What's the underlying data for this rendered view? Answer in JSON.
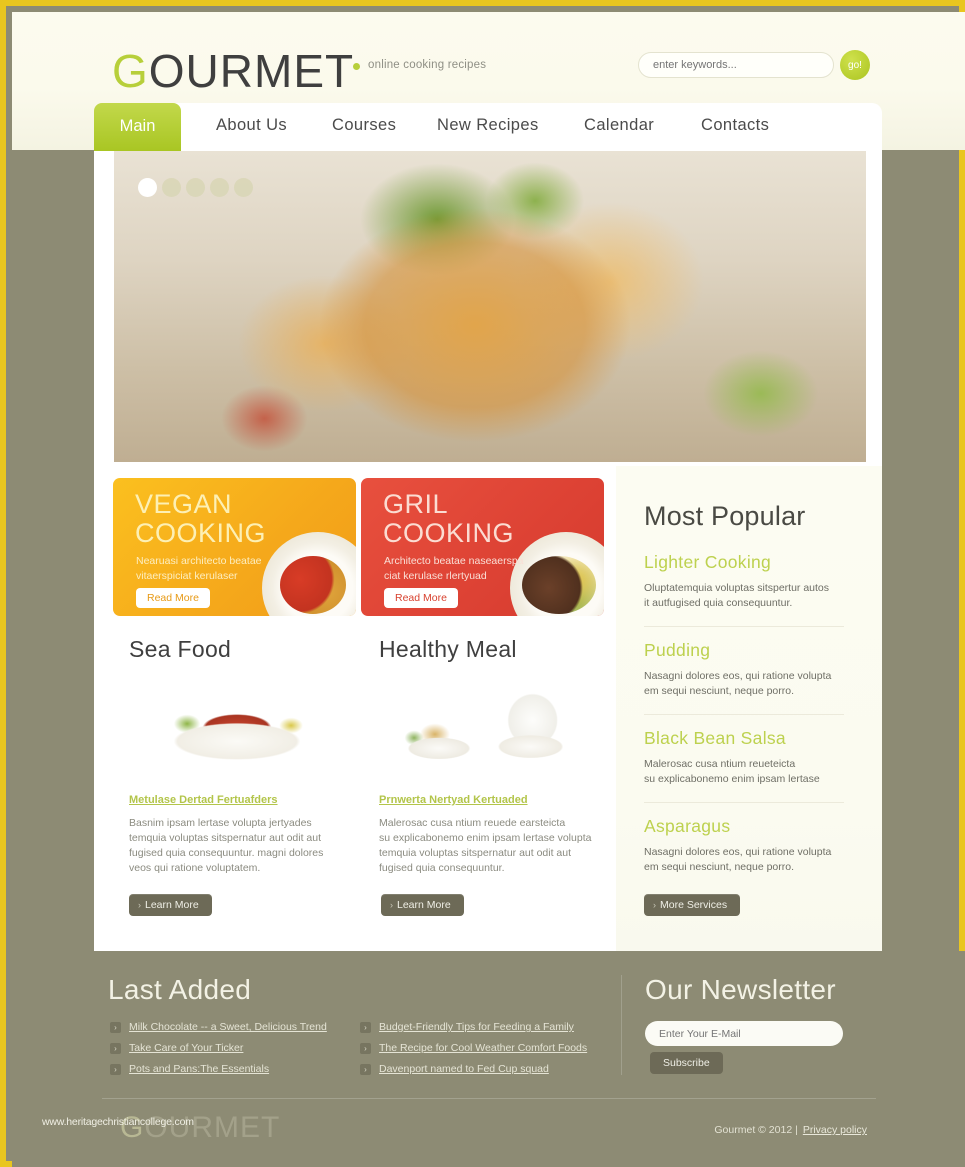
{
  "site": {
    "logo_g": "G",
    "logo_rest": "OURMET",
    "tagline": "online cooking recipes"
  },
  "search": {
    "placeholder": "enter keywords...",
    "value": "",
    "button_label": "go!"
  },
  "nav": {
    "items": [
      {
        "label": "Main",
        "active": true
      },
      {
        "label": "About Us",
        "active": false
      },
      {
        "label": "Courses",
        "active": false
      },
      {
        "label": "New Recipes",
        "active": false
      },
      {
        "label": "Calendar",
        "active": false
      },
      {
        "label": "Contacts",
        "active": false
      }
    ]
  },
  "slider": {
    "dots": 5,
    "active_index": 0
  },
  "promos": [
    {
      "title_line1": "VEGAN",
      "title_line2": "COOKING",
      "desc_line1": "Nearuasi architecto beatae",
      "desc_line2": "vitaerspiciat kerulaser",
      "button_label": "Read More",
      "color": "#f5a81b"
    },
    {
      "title_line1": "GRIL",
      "title_line2": "COOKING",
      "desc_line1": "Architecto beatae naseaerspa",
      "desc_line2": "ciat kerulase rlertyuad",
      "button_label": "Read More",
      "color": "#dd4234"
    }
  ],
  "sidebar": {
    "title": "Most Popular",
    "items": [
      {
        "heading": "Lighter Cooking",
        "line1": "Oluptatemquia voluptas sitspertur autos",
        "line2": "it autfugised quia consequuntur."
      },
      {
        "heading": "Pudding",
        "line1": "Nasagni dolores eos, qui ratione volupta",
        "line2": "em sequi nesciunt, neque porro."
      },
      {
        "heading": "Black Bean Salsa",
        "line1": "Malerosac cusa ntium reueteicta",
        "line2": "su explicabonemo enim ipsam lertase"
      },
      {
        "heading": "Asparagus",
        "line1": "Nasagni dolores eos, qui ratione volupta",
        "line2": "em sequi nesciunt, neque porro."
      }
    ],
    "more_button": "More Services"
  },
  "columns": [
    {
      "heading": "Sea Food",
      "link": "Metulase Dertad Fertuafders",
      "body_line1": "Basnim ipsam lertase volupta jertyades",
      "body_line2": "temquia voluptas sitspernatur aut odit aut",
      "body_line3": "fugised quia consequuntur. magni dolores",
      "body_line4": "veos qui ratione voluptatem.",
      "button_label": "Learn More"
    },
    {
      "heading": "Healthy Meal",
      "link": "Prnwerta Nertyad Kertuaded",
      "body_line1": "Malerosac cusa ntium reuede earsteicta",
      "body_line2": "su explicabonemo enim ipsam lertase volupta",
      "body_line3": "temquia voluptas sitspernatur aut odit aut",
      "body_line4": "fugised quia consequuntur.",
      "button_label": "Learn More"
    }
  ],
  "footer": {
    "last_added_title": "Last Added",
    "links_col1": [
      "Milk Chocolate -- a Sweet, Delicious Trend",
      "Take Care of Your Ticker",
      "Pots and Pans:The Essentials"
    ],
    "links_col2": [
      "Budget-Friendly Tips for Feeding a Family",
      "The Recipe for Cool Weather Comfort Foods",
      "Davenport named to Fed Cup squad"
    ],
    "newsletter_title": "Our Newsletter",
    "newsletter_placeholder": "Enter Your E-Mail",
    "newsletter_value": "",
    "subscribe_label": "Subscribe",
    "logo_g": "G",
    "logo_rest": "OURMET",
    "copyright": "Gourmet © 2012  |",
    "privacy": "Privacy policy",
    "watermark": "www.heritagechristiancollege.com"
  },
  "icons": {
    "bullet": "›",
    "arrow": "›",
    "tagline_dot": "dot"
  }
}
